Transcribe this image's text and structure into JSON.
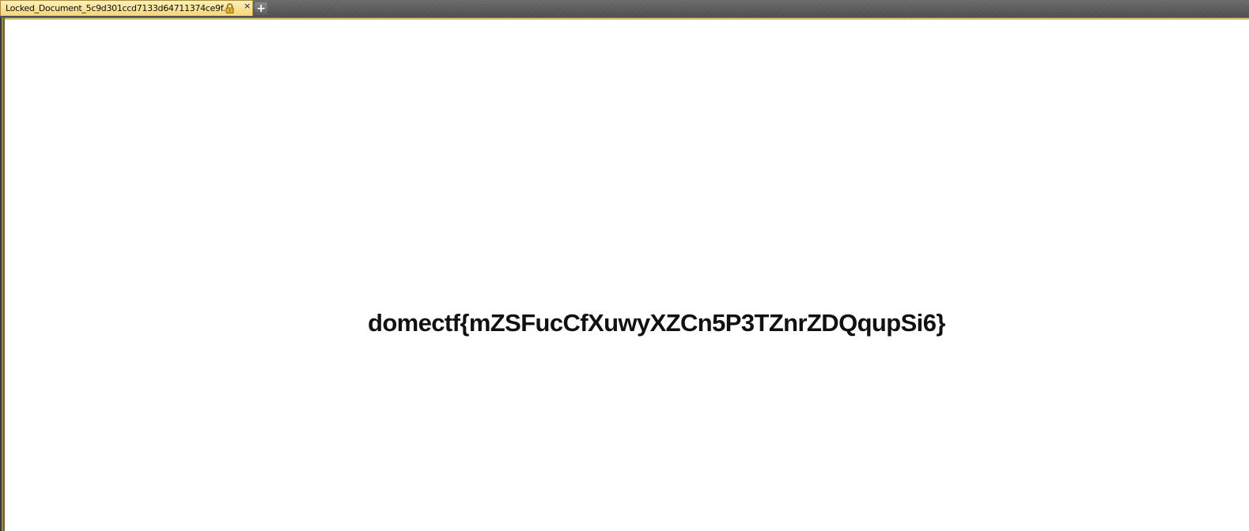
{
  "tab": {
    "title": "Locked_Document_5c9d301ccd7133d64711374ce9f..",
    "close_glyph": "×",
    "lock_icon": "lock-icon",
    "new_tab_glyph": "+"
  },
  "document": {
    "text": "domectf{mZSFucCfXuwyXZCn5P3TZnrZDQqupSi6}"
  },
  "colors": {
    "tab_background": "#f6df8a",
    "tabbar_background": "#5a5a5a",
    "accent": "#d9c67a",
    "text": "#111111"
  }
}
